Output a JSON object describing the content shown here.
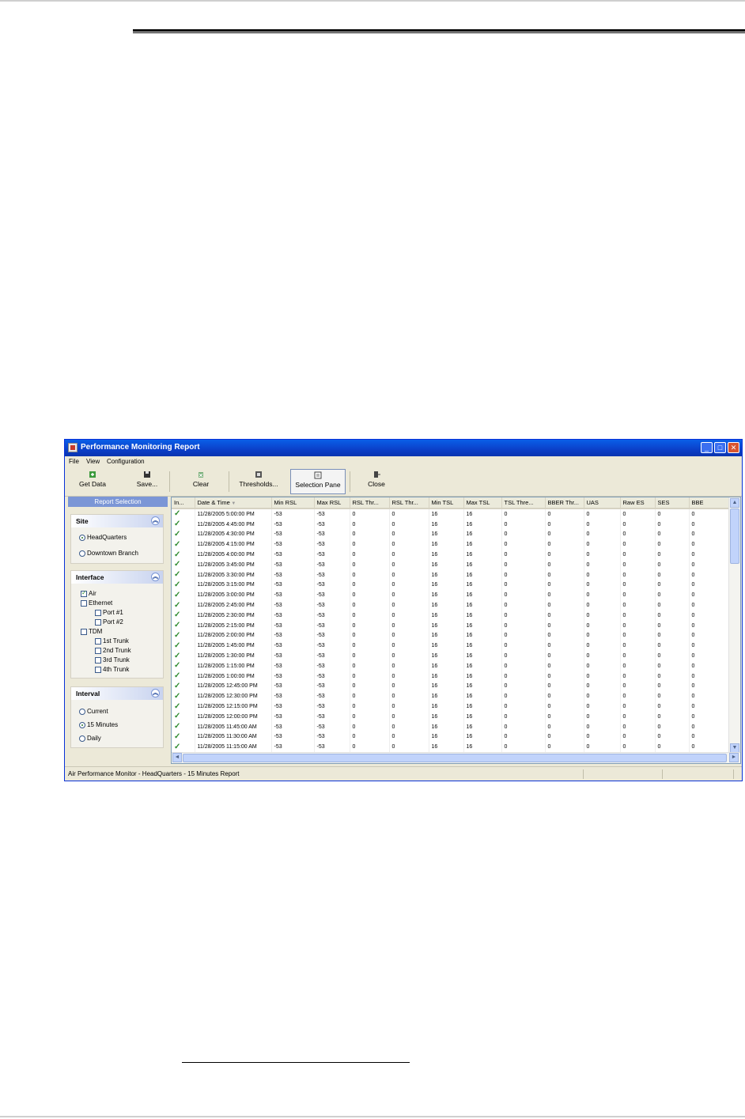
{
  "window": {
    "title": "Performance Monitoring Report"
  },
  "menu": [
    "File",
    "View",
    "Configuration"
  ],
  "toolbar": {
    "get_data": "Get Data",
    "save": "Save...",
    "clear": "Clear",
    "thresholds": "Thresholds...",
    "selection_pane": "Selection Pane",
    "close": "Close"
  },
  "icons": {
    "get_data": "get-data-icon",
    "save": "floppy-disk-icon",
    "clear": "clear-icon",
    "thresholds": "thresholds-icon",
    "selection_pane": "selection-pane-icon",
    "close": "close-door-icon"
  },
  "sidebar": {
    "header": "Report Selection",
    "site": {
      "title": "Site",
      "options": [
        "HeadQuarters",
        "Downtown Branch"
      ],
      "selected": "HeadQuarters"
    },
    "interface": {
      "title": "Interface",
      "items": [
        {
          "label": "Air",
          "checked": true
        },
        {
          "label": "Ethernet",
          "checked": false
        },
        {
          "label": "Port #1",
          "checked": false
        },
        {
          "label": "Port #2",
          "checked": false
        },
        {
          "label": "TDM",
          "checked": false
        },
        {
          "label": "1st Trunk",
          "checked": false
        },
        {
          "label": "2nd Trunk",
          "checked": false
        },
        {
          "label": "3rd Trunk",
          "checked": false
        },
        {
          "label": "4th Trunk",
          "checked": false
        }
      ]
    },
    "interval": {
      "title": "Interval",
      "options": [
        "Current",
        "15 Minutes",
        "Daily"
      ],
      "selected": "15 Minutes"
    }
  },
  "table": {
    "columns": [
      "In...",
      "Date & Time",
      "Min RSL",
      "Max RSL",
      "RSL Thr...",
      "RSL Thr...",
      "Min TSL",
      "Max TSL",
      "TSL Thre...",
      "BBER Thr...",
      "UAS",
      "Raw ES",
      "SES",
      "BBE"
    ],
    "rows": [
      [
        "11/28/2005 5:00:00 PM",
        "-53",
        "-53",
        "0",
        "0",
        "16",
        "16",
        "0",
        "0",
        "0",
        "0",
        "0",
        "0"
      ],
      [
        "11/28/2005 4:45:00 PM",
        "-53",
        "-53",
        "0",
        "0",
        "16",
        "16",
        "0",
        "0",
        "0",
        "0",
        "0",
        "0"
      ],
      [
        "11/28/2005 4:30:00 PM",
        "-53",
        "-53",
        "0",
        "0",
        "16",
        "16",
        "0",
        "0",
        "0",
        "0",
        "0",
        "0"
      ],
      [
        "11/28/2005 4:15:00 PM",
        "-53",
        "-53",
        "0",
        "0",
        "16",
        "16",
        "0",
        "0",
        "0",
        "0",
        "0",
        "0"
      ],
      [
        "11/28/2005 4:00:00 PM",
        "-53",
        "-53",
        "0",
        "0",
        "16",
        "16",
        "0",
        "0",
        "0",
        "0",
        "0",
        "0"
      ],
      [
        "11/28/2005 3:45:00 PM",
        "-53",
        "-53",
        "0",
        "0",
        "16",
        "16",
        "0",
        "0",
        "0",
        "0",
        "0",
        "0"
      ],
      [
        "11/28/2005 3:30:00 PM",
        "-53",
        "-53",
        "0",
        "0",
        "16",
        "16",
        "0",
        "0",
        "0",
        "0",
        "0",
        "0"
      ],
      [
        "11/28/2005 3:15:00 PM",
        "-53",
        "-53",
        "0",
        "0",
        "16",
        "16",
        "0",
        "0",
        "0",
        "0",
        "0",
        "0"
      ],
      [
        "11/28/2005 3:00:00 PM",
        "-53",
        "-53",
        "0",
        "0",
        "16",
        "16",
        "0",
        "0",
        "0",
        "0",
        "0",
        "0"
      ],
      [
        "11/28/2005 2:45:00 PM",
        "-53",
        "-53",
        "0",
        "0",
        "16",
        "16",
        "0",
        "0",
        "0",
        "0",
        "0",
        "0"
      ],
      [
        "11/28/2005 2:30:00 PM",
        "-53",
        "-53",
        "0",
        "0",
        "16",
        "16",
        "0",
        "0",
        "0",
        "0",
        "0",
        "0"
      ],
      [
        "11/28/2005 2:15:00 PM",
        "-53",
        "-53",
        "0",
        "0",
        "16",
        "16",
        "0",
        "0",
        "0",
        "0",
        "0",
        "0"
      ],
      [
        "11/28/2005 2:00:00 PM",
        "-53",
        "-53",
        "0",
        "0",
        "16",
        "16",
        "0",
        "0",
        "0",
        "0",
        "0",
        "0"
      ],
      [
        "11/28/2005 1:45:00 PM",
        "-53",
        "-53",
        "0",
        "0",
        "16",
        "16",
        "0",
        "0",
        "0",
        "0",
        "0",
        "0"
      ],
      [
        "11/28/2005 1:30:00 PM",
        "-53",
        "-53",
        "0",
        "0",
        "16",
        "16",
        "0",
        "0",
        "0",
        "0",
        "0",
        "0"
      ],
      [
        "11/28/2005 1:15:00 PM",
        "-53",
        "-53",
        "0",
        "0",
        "16",
        "16",
        "0",
        "0",
        "0",
        "0",
        "0",
        "0"
      ],
      [
        "11/28/2005 1:00:00 PM",
        "-53",
        "-53",
        "0",
        "0",
        "16",
        "16",
        "0",
        "0",
        "0",
        "0",
        "0",
        "0"
      ],
      [
        "11/28/2005 12:45:00 PM",
        "-53",
        "-53",
        "0",
        "0",
        "16",
        "16",
        "0",
        "0",
        "0",
        "0",
        "0",
        "0"
      ],
      [
        "11/28/2005 12:30:00 PM",
        "-53",
        "-53",
        "0",
        "0",
        "16",
        "16",
        "0",
        "0",
        "0",
        "0",
        "0",
        "0"
      ],
      [
        "11/28/2005 12:15:00 PM",
        "-53",
        "-53",
        "0",
        "0",
        "16",
        "16",
        "0",
        "0",
        "0",
        "0",
        "0",
        "0"
      ],
      [
        "11/28/2005 12:00:00 PM",
        "-53",
        "-53",
        "0",
        "0",
        "16",
        "16",
        "0",
        "0",
        "0",
        "0",
        "0",
        "0"
      ],
      [
        "11/28/2005 11:45:00 AM",
        "-53",
        "-53",
        "0",
        "0",
        "16",
        "16",
        "0",
        "0",
        "0",
        "0",
        "0",
        "0"
      ],
      [
        "11/28/2005 11:30:00 AM",
        "-53",
        "-53",
        "0",
        "0",
        "16",
        "16",
        "0",
        "0",
        "0",
        "0",
        "0",
        "0"
      ],
      [
        "11/28/2005 11:15:00 AM",
        "-53",
        "-53",
        "0",
        "0",
        "16",
        "16",
        "0",
        "0",
        "0",
        "0",
        "0",
        "0"
      ]
    ]
  },
  "status": {
    "text": "Air Performance Monitor - HeadQuarters - 15 Minutes Report"
  },
  "colors": {
    "titlebar": "#0b3fc8",
    "check": "#2e8b2e",
    "pane_header": "#7b96d6"
  }
}
